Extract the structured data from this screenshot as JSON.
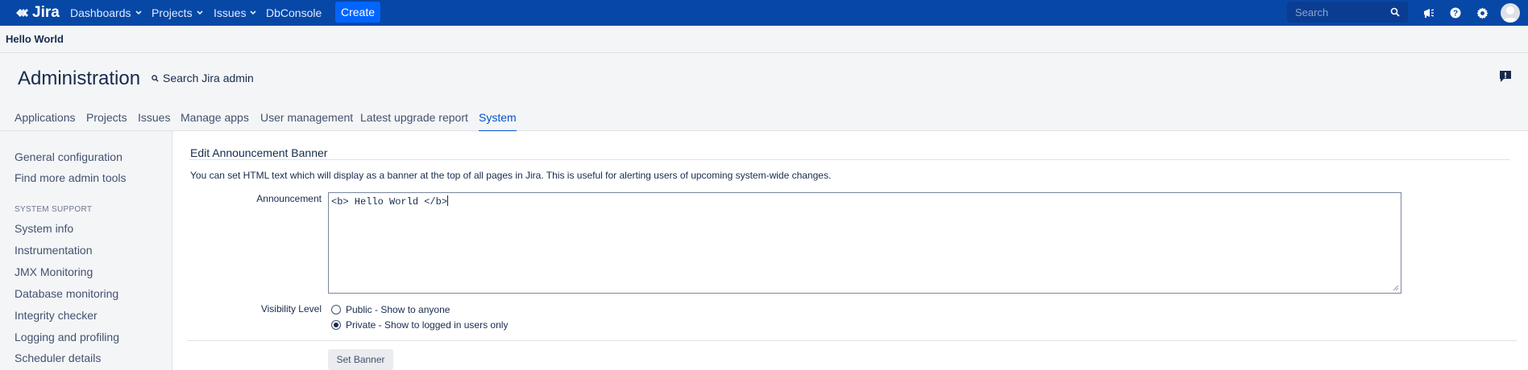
{
  "topnav": {
    "logo_text": "Jira",
    "items": [
      {
        "label": "Dashboards",
        "has_dropdown": true
      },
      {
        "label": "Projects",
        "has_dropdown": true
      },
      {
        "label": "Issues",
        "has_dropdown": true
      },
      {
        "label": "DbConsole",
        "has_dropdown": false
      }
    ],
    "create_label": "Create",
    "search_placeholder": "Search",
    "icons": [
      "megaphone-icon",
      "help-icon",
      "settings-icon",
      "avatar"
    ],
    "accent_color": "#0747a6"
  },
  "banner": {
    "text": "Hello World"
  },
  "admin": {
    "title": "Administration",
    "search_label": "Search Jira admin",
    "tabs": [
      {
        "label": "Applications"
      },
      {
        "label": "Projects"
      },
      {
        "label": "Issues"
      },
      {
        "label": "Manage apps"
      },
      {
        "label": "User management"
      },
      {
        "label": "Latest upgrade report"
      },
      {
        "label": "System",
        "active": true
      }
    ]
  },
  "sidebar": {
    "top_links": [
      "General configuration",
      "Find more admin tools"
    ],
    "section_heading": "SYSTEM SUPPORT",
    "section_links": [
      "System info",
      "Instrumentation",
      "JMX Monitoring",
      "Database monitoring",
      "Integrity checker",
      "Logging and profiling",
      "Scheduler details"
    ]
  },
  "main": {
    "title": "Edit Announcement Banner",
    "description": "You can set HTML text which will display as a banner at the top of all pages in Jira. This is useful for alerting users of upcoming system-wide changes.",
    "announcement_label": "Announcement",
    "announcement_value": "<b> Hello World </b>",
    "visibility_label": "Visibility Level",
    "visibility_options": [
      {
        "label": "Public - Show to anyone",
        "checked": false
      },
      {
        "label": "Private - Show to logged in users only",
        "checked": true
      }
    ],
    "submit_label": "Set Banner"
  }
}
